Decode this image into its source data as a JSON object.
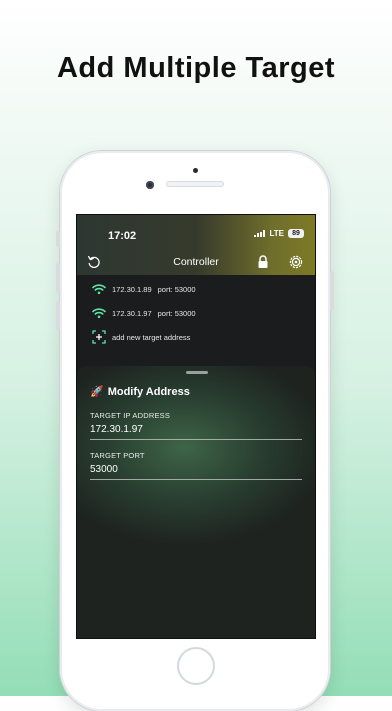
{
  "headline": "Add Multiple Target",
  "status": {
    "time": "17:02",
    "network": "LTE",
    "battery": "89"
  },
  "nav": {
    "title": "Controller"
  },
  "targets": [
    {
      "ip": "172.30.1.89",
      "port": "port: 53000"
    },
    {
      "ip": "172.30.1.97",
      "port": "port: 53000"
    }
  ],
  "add_target": {
    "label": "add new target address"
  },
  "sheet": {
    "emoji": "🚀",
    "title": "Modify Address",
    "ip_label": "TARGET IP ADDRESS",
    "ip_value": "172.30.1.97",
    "port_label": "TARGET PORT",
    "port_value": "53000"
  },
  "icons": {
    "wifi": "wifi-icon",
    "refresh": "refresh-icon",
    "lock": "lock-icon",
    "settings": "settings-gear-icon",
    "add": "add-target-icon"
  },
  "colors": {
    "accent_green": "#5fe3a4",
    "header_olive": "#7e7a25",
    "screen_bg": "#1b1c1e"
  }
}
